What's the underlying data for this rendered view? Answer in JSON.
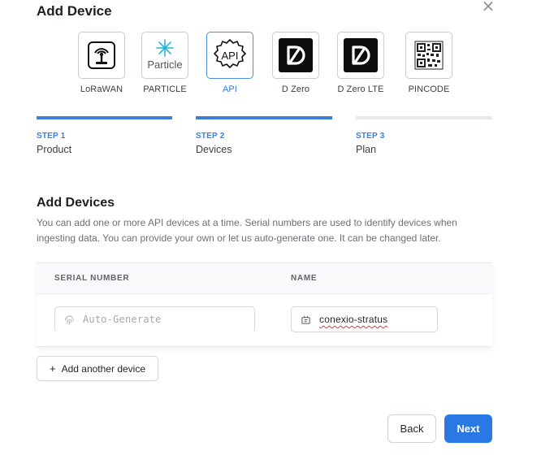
{
  "modal": {
    "title": "Add Device",
    "close_label": "×"
  },
  "device_types": [
    {
      "label": "LoRaWAN",
      "icon": "lorawan-icon",
      "selected": false
    },
    {
      "label": "PARTICLE",
      "icon": "particle-icon",
      "logo_text": "Particle",
      "selected": false
    },
    {
      "label": "API",
      "icon": "api-gear-icon",
      "logo_text": "API",
      "selected": true
    },
    {
      "label": "D Zero",
      "icon": "d-zero-icon",
      "selected": false
    },
    {
      "label": "D Zero LTE",
      "icon": "d-zero-lte-icon",
      "selected": false
    },
    {
      "label": "PINCODE",
      "icon": "qr-code-icon",
      "selected": false
    }
  ],
  "steps": [
    {
      "number": "STEP 1",
      "name": "Product",
      "status": "complete"
    },
    {
      "number": "STEP 2",
      "name": "Devices",
      "status": "current"
    },
    {
      "number": "STEP 3",
      "name": "Plan",
      "status": "upcoming"
    }
  ],
  "section": {
    "title": "Add Devices",
    "description": "You can add one or more API devices at a time. Serial numbers are used to identify devices when ingesting data. You can provide your own or let us auto-generate one. It can be changed later."
  },
  "table": {
    "headers": {
      "serial": "SERIAL NUMBER",
      "name": "NAME"
    },
    "rows": [
      {
        "serial_placeholder": "Auto-Generate",
        "serial_value": "",
        "name_value": "conexio-stratus"
      }
    ]
  },
  "actions": {
    "add_device_label": "Add another device",
    "back_label": "Back",
    "next_label": "Next"
  },
  "colors": {
    "accent": "#2a78e4",
    "step_complete": "#3b7fd6",
    "step_upcoming": "#e6e8eb"
  }
}
